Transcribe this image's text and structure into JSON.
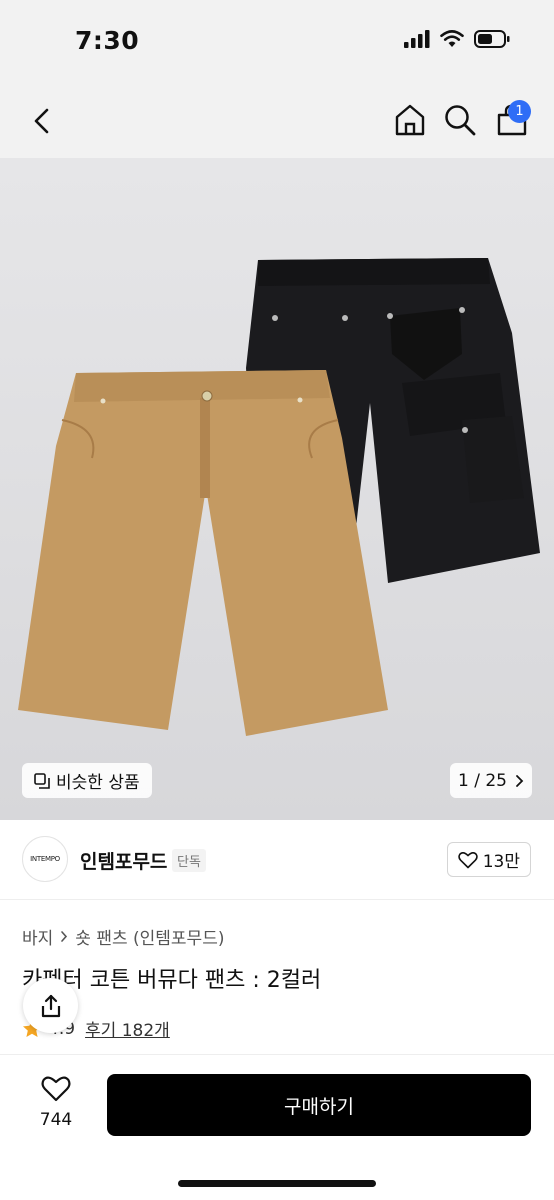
{
  "status_bar": {
    "time": "7:30"
  },
  "nav": {
    "cart_count": "1"
  },
  "gallery": {
    "similar_label": "비슷한 상품",
    "counter": "1 / 25"
  },
  "brand": {
    "logo_text": "INTEMPO",
    "name": "인템포무드",
    "tag": "단독",
    "like_count": "13만"
  },
  "breadcrumb": [
    "바지",
    "숏 팬츠 (인템포무드)"
  ],
  "product": {
    "title": "카펜터 코튼 버뮤다 팬츠 : 2컬러",
    "rating": "4.9",
    "reviews": "후기 182개"
  },
  "bottom": {
    "wish_count": "744",
    "buy_label": "구매하기"
  },
  "colors": {
    "accent": "#2f6df6",
    "star": "#f5a623",
    "tan": "#c49a62",
    "black_item": "#1b1b1e"
  }
}
